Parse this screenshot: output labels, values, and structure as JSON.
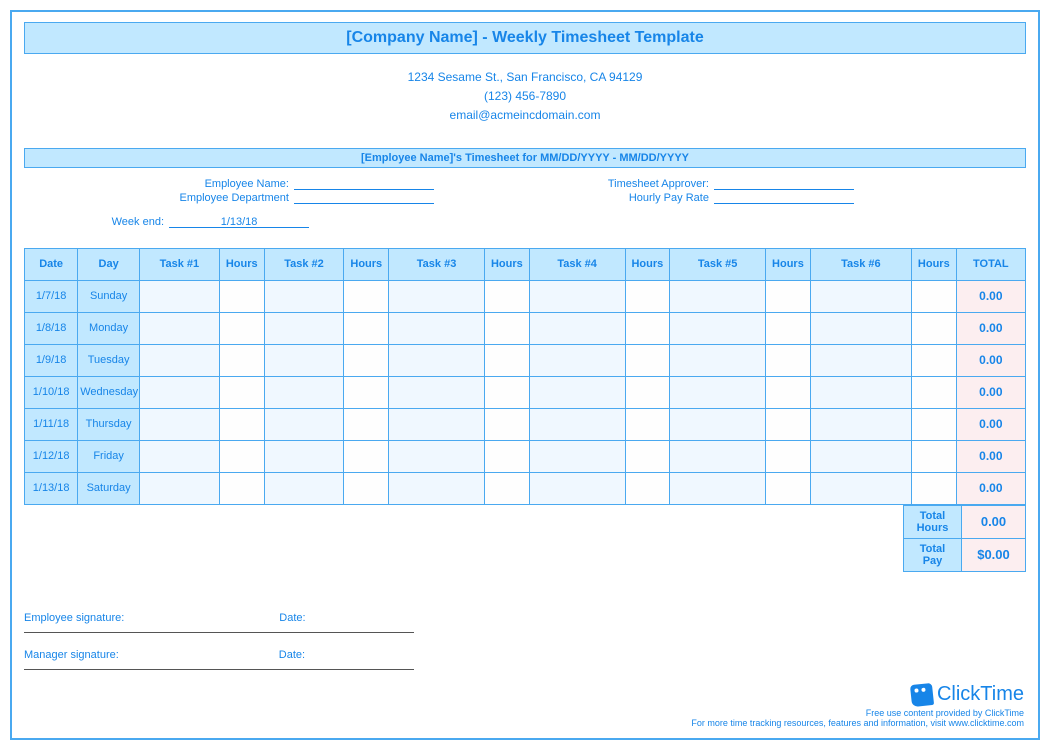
{
  "title": "[Company Name] - Weekly Timesheet Template",
  "contact": {
    "address": "1234 Sesame St.,  San Francisco, CA 94129",
    "phone": "(123) 456-7890",
    "email": "email@acmeincdomain.com"
  },
  "subheader": "[Employee Name]'s Timesheet for MM/DD/YYYY - MM/DD/YYYY",
  "meta": {
    "emp_name_label": "Employee Name:",
    "emp_dept_label": "Employee Department",
    "approver_label": "Timesheet Approver:",
    "rate_label": "Hourly Pay Rate",
    "week_end_label": "Week end:",
    "week_end_value": "1/13/18"
  },
  "columns": {
    "date": "Date",
    "day": "Day",
    "task1": "Task #1",
    "task2": "Task #2",
    "task3": "Task #3",
    "task4": "Task #4",
    "task5": "Task #5",
    "task6": "Task #6",
    "hours": "Hours",
    "total": "TOTAL"
  },
  "rows": [
    {
      "date": "1/7/18",
      "day": "Sunday",
      "total": "0.00"
    },
    {
      "date": "1/8/18",
      "day": "Monday",
      "total": "0.00"
    },
    {
      "date": "1/9/18",
      "day": "Tuesday",
      "total": "0.00"
    },
    {
      "date": "1/10/18",
      "day": "Wednesday",
      "total": "0.00"
    },
    {
      "date": "1/11/18",
      "day": "Thursday",
      "total": "0.00"
    },
    {
      "date": "1/12/18",
      "day": "Friday",
      "total": "0.00"
    },
    {
      "date": "1/13/18",
      "day": "Saturday",
      "total": "0.00"
    }
  ],
  "summary": {
    "total_hours_label": "Total Hours",
    "total_hours_value": "0.00",
    "total_pay_label": "Total Pay",
    "total_pay_value": "$0.00"
  },
  "signatures": {
    "emp_sig": "Employee signature:",
    "mgr_sig": "Manager signature:",
    "date": "Date:"
  },
  "footer": {
    "brand": "ClickTime",
    "line1": "Free use content provided by ClickTime",
    "line2": "For more time tracking resources, features and information, visit www.clicktime.com"
  }
}
